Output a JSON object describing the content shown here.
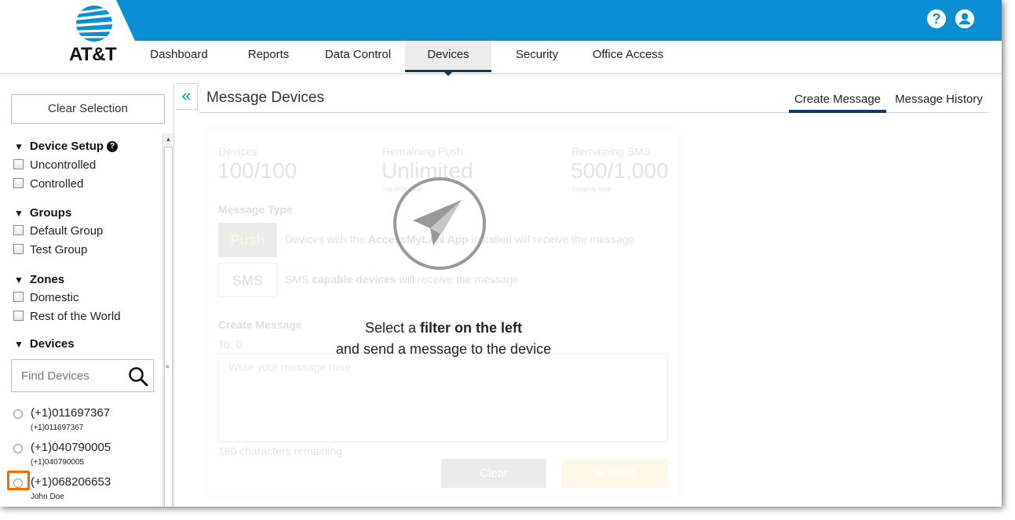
{
  "brand": {
    "name": "AT&T",
    "accent": "#0a8fd4",
    "dark_accent": "#0a3d6b",
    "highlight": "#ff6a00"
  },
  "header": {
    "icons": [
      "help-icon",
      "user-icon"
    ]
  },
  "nav": {
    "items": [
      "Dashboard",
      "Reports",
      "Data Control",
      "Devices",
      "Security",
      "Office Access"
    ],
    "active": "Devices"
  },
  "sidebar": {
    "clear_label": "Clear Selection",
    "device_setup": {
      "title": "Device Setup",
      "options": [
        "Uncontrolled",
        "Controlled"
      ]
    },
    "groups": {
      "title": "Groups",
      "options": [
        "Default Group",
        "Test Group"
      ]
    },
    "zones": {
      "title": "Zones",
      "options": [
        "Domestic",
        "Rest of the World"
      ]
    },
    "devices": {
      "title": "Devices",
      "search_placeholder": "Find Devices",
      "list": [
        {
          "number": "(+1)011697367",
          "sub": "(+1)011697367"
        },
        {
          "number": "(+1)040790005",
          "sub": "(+1)040790005"
        },
        {
          "number": "(+1)068206653",
          "sub": "John Doe"
        }
      ]
    }
  },
  "main": {
    "title": "Message Devices",
    "tabs": [
      "Create Message",
      "Message History"
    ],
    "active_tab": "Create Message",
    "stats": {
      "devices_label": "Devices",
      "devices_value": "100/100",
      "push_label": "Remaining Push",
      "push_value": "Unlimited",
      "push_sub": "monthly total",
      "sms_label": "Remaining SMS",
      "sms_value": "500/1,000",
      "sms_sub": "monthly total"
    },
    "message_type_label": "Message Type",
    "push_label": "Push",
    "push_desc_pre": "Devices with the ",
    "push_desc_bold": "AccessMyLAN App",
    "push_desc_post": " installed will receive the message",
    "sms_label": "SMS",
    "sms_desc_pre": "SMS ",
    "sms_desc_bold": "capable devices",
    "sms_desc_post": " will receive the message",
    "create_label": "Create Message",
    "to_label": "To: 0",
    "message_placeholder": "Write your message here",
    "chars_remaining": "160 characters remaining",
    "clear_button": "Clear",
    "send_button": "Send",
    "overlay_line1_pre": "Select a ",
    "overlay_line1_bold": "filter on the left",
    "overlay_line2": "and send a message to the device"
  }
}
